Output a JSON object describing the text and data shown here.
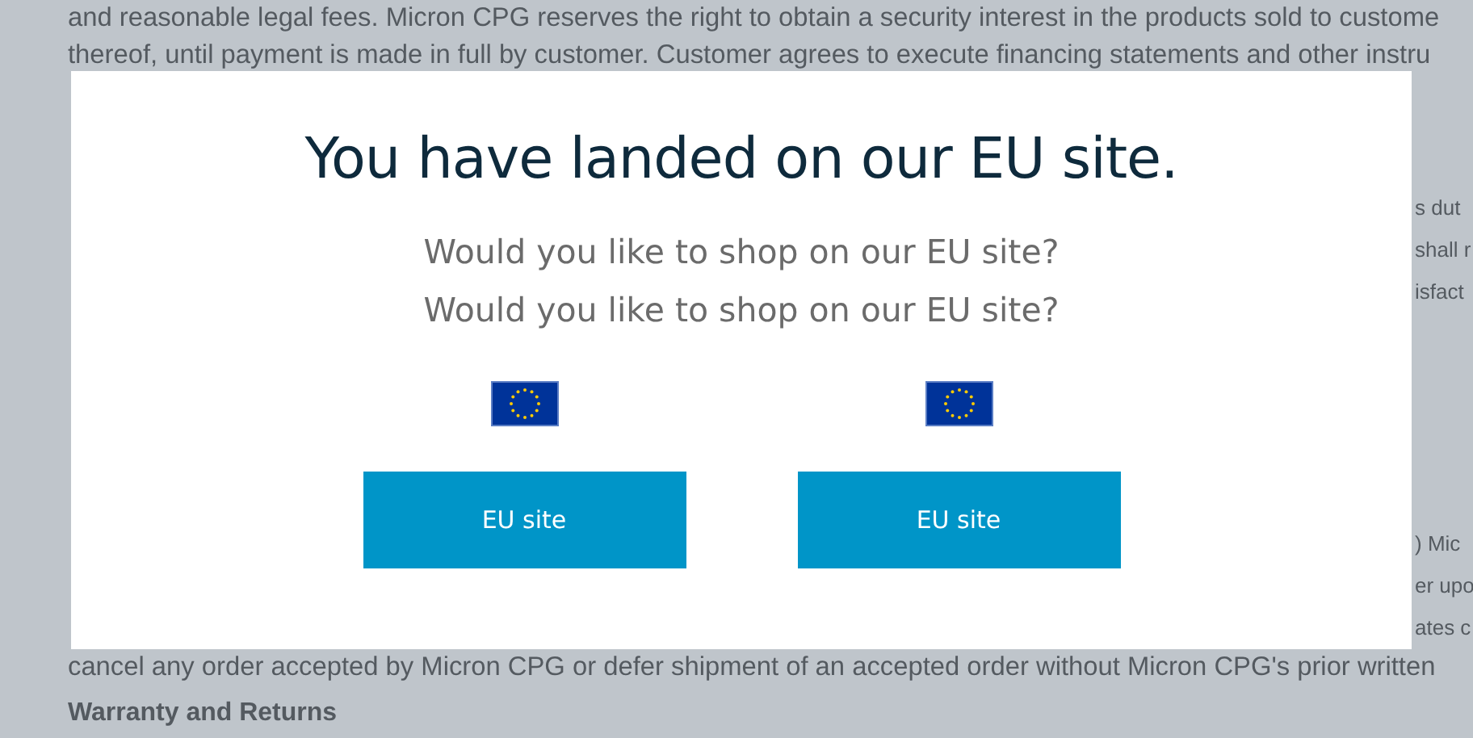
{
  "page": {
    "top_lines": [
      "and reasonable legal fees. Micron CPG reserves the right to obtain a security interest in the products sold to custome",
      "thereof, until payment is made in full by customer. Customer agrees to execute financing statements and other instru"
    ],
    "cut_fragments": [
      [
        "s dut",
        "shall r",
        "isfact"
      ],
      [
        ") Mic",
        "er upo",
        "ates c"
      ]
    ],
    "bottom_line": "cancel any order accepted by Micron CPG or defer shipment of an accepted order without Micron CPG's prior written",
    "heading": "Warranty and Returns"
  },
  "dialog": {
    "title": "You have landed on our EU site.",
    "messages": [
      "Would you like to shop on our EU site?",
      "Would you like to shop on our EU site?"
    ],
    "options": [
      {
        "button": "EU site"
      },
      {
        "button": "EU site"
      }
    ]
  }
}
